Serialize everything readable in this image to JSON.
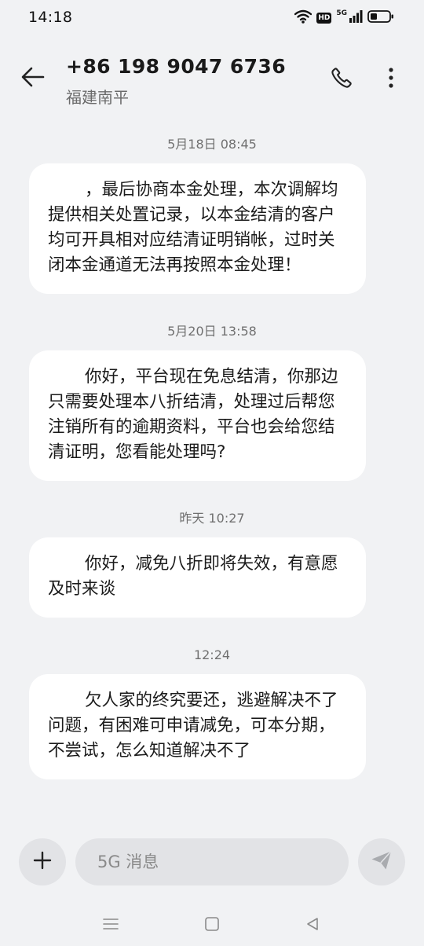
{
  "status_bar": {
    "time": "14:18",
    "hd_label": "HD",
    "network_label": "5G"
  },
  "header": {
    "contact_number": "+86 198 9047 6736",
    "contact_location": "福建南平"
  },
  "messages": [
    {
      "timestamp": "5月18日 08:45",
      "text": "，最后协商本金处理，本次调解均提供相关处置记录，以本金结清的客户均可开具相对应结清证明销帐，过时关闭本金通道无法再按照本金处理！"
    },
    {
      "timestamp": "5月20日 13:58",
      "text": "你好，平台现在免息结清，你那边只需要处理本八折结清，处理过后帮您注销所有的逾期资料，平台也会给您结清证明，您看能处理吗?"
    },
    {
      "timestamp": "昨天 10:27",
      "text": "你好，减免八折即将失效，有意愿及时来谈"
    },
    {
      "timestamp": "12:24",
      "text": "欠人家的终究要还，逃避解决不了问题，有困难可申请减免，可本分期，不尝试，怎么知道解决不了"
    }
  ],
  "composer": {
    "placeholder": "5G 消息"
  },
  "icons": {
    "back": "arrow-left-icon",
    "call": "phone-icon",
    "more": "more-vertical-icon",
    "add": "plus-icon",
    "send": "send-icon",
    "nav_menu": "menu-icon",
    "nav_home": "home-icon",
    "nav_back": "back-triangle-icon"
  },
  "colors": {
    "background": "#f1f2f4",
    "bubble": "#ffffff",
    "control": "#e2e3e6",
    "timestamp": "#707070"
  }
}
